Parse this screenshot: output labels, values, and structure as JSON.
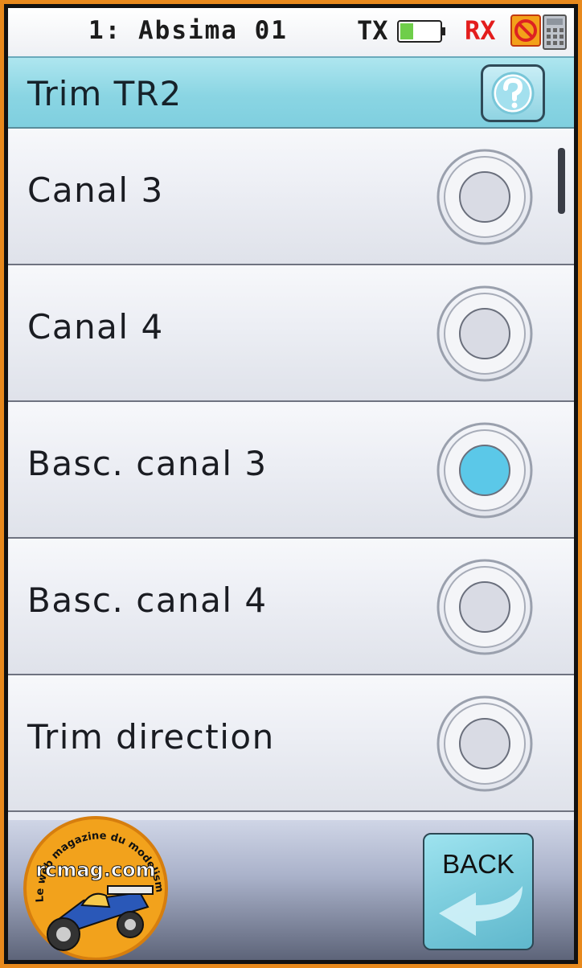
{
  "status_bar": {
    "model_name": "1: Absima 01",
    "tx_label": "TX",
    "rx_label": "RX",
    "battery_level": 0.3
  },
  "header": {
    "title": "Trim TR2",
    "help_icon": "question-mark-icon"
  },
  "options": [
    {
      "label": "Canal 3",
      "selected": false
    },
    {
      "label": "Canal 4",
      "selected": false
    },
    {
      "label": "Basc. canal 3",
      "selected": true
    },
    {
      "label": "Basc. canal 4",
      "selected": false
    },
    {
      "label": "Trim direction",
      "selected": false
    }
  ],
  "footer": {
    "back_label": "BACK",
    "back_icon": "return-arrow-icon"
  },
  "watermark": {
    "site": "rcmag.com",
    "tagline": "Le web magazine du modelisme"
  },
  "colors": {
    "frame": "#e8891c",
    "accent": "#8ad5e3",
    "rx": "#e31d1d",
    "selected_dot": "#5bc8e8"
  }
}
